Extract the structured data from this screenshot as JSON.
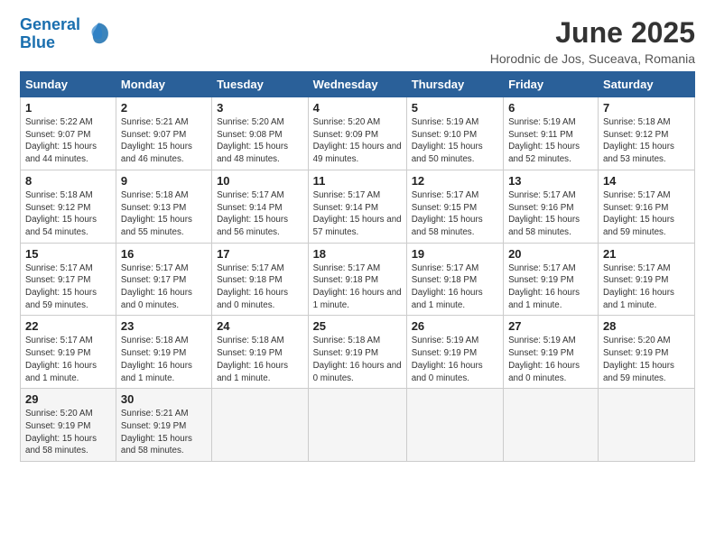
{
  "logo": {
    "line1": "General",
    "line2": "Blue"
  },
  "title": "June 2025",
  "subtitle": "Horodnic de Jos, Suceava, Romania",
  "weekdays": [
    "Sunday",
    "Monday",
    "Tuesday",
    "Wednesday",
    "Thursday",
    "Friday",
    "Saturday"
  ],
  "weeks": [
    [
      {
        "day": "1",
        "sunrise": "Sunrise: 5:22 AM",
        "sunset": "Sunset: 9:07 PM",
        "daylight": "Daylight: 15 hours and 44 minutes."
      },
      {
        "day": "2",
        "sunrise": "Sunrise: 5:21 AM",
        "sunset": "Sunset: 9:07 PM",
        "daylight": "Daylight: 15 hours and 46 minutes."
      },
      {
        "day": "3",
        "sunrise": "Sunrise: 5:20 AM",
        "sunset": "Sunset: 9:08 PM",
        "daylight": "Daylight: 15 hours and 48 minutes."
      },
      {
        "day": "4",
        "sunrise": "Sunrise: 5:20 AM",
        "sunset": "Sunset: 9:09 PM",
        "daylight": "Daylight: 15 hours and 49 minutes."
      },
      {
        "day": "5",
        "sunrise": "Sunrise: 5:19 AM",
        "sunset": "Sunset: 9:10 PM",
        "daylight": "Daylight: 15 hours and 50 minutes."
      },
      {
        "day": "6",
        "sunrise": "Sunrise: 5:19 AM",
        "sunset": "Sunset: 9:11 PM",
        "daylight": "Daylight: 15 hours and 52 minutes."
      },
      {
        "day": "7",
        "sunrise": "Sunrise: 5:18 AM",
        "sunset": "Sunset: 9:12 PM",
        "daylight": "Daylight: 15 hours and 53 minutes."
      }
    ],
    [
      {
        "day": "8",
        "sunrise": "Sunrise: 5:18 AM",
        "sunset": "Sunset: 9:12 PM",
        "daylight": "Daylight: 15 hours and 54 minutes."
      },
      {
        "day": "9",
        "sunrise": "Sunrise: 5:18 AM",
        "sunset": "Sunset: 9:13 PM",
        "daylight": "Daylight: 15 hours and 55 minutes."
      },
      {
        "day": "10",
        "sunrise": "Sunrise: 5:17 AM",
        "sunset": "Sunset: 9:14 PM",
        "daylight": "Daylight: 15 hours and 56 minutes."
      },
      {
        "day": "11",
        "sunrise": "Sunrise: 5:17 AM",
        "sunset": "Sunset: 9:14 PM",
        "daylight": "Daylight: 15 hours and 57 minutes."
      },
      {
        "day": "12",
        "sunrise": "Sunrise: 5:17 AM",
        "sunset": "Sunset: 9:15 PM",
        "daylight": "Daylight: 15 hours and 58 minutes."
      },
      {
        "day": "13",
        "sunrise": "Sunrise: 5:17 AM",
        "sunset": "Sunset: 9:16 PM",
        "daylight": "Daylight: 15 hours and 58 minutes."
      },
      {
        "day": "14",
        "sunrise": "Sunrise: 5:17 AM",
        "sunset": "Sunset: 9:16 PM",
        "daylight": "Daylight: 15 hours and 59 minutes."
      }
    ],
    [
      {
        "day": "15",
        "sunrise": "Sunrise: 5:17 AM",
        "sunset": "Sunset: 9:17 PM",
        "daylight": "Daylight: 15 hours and 59 minutes."
      },
      {
        "day": "16",
        "sunrise": "Sunrise: 5:17 AM",
        "sunset": "Sunset: 9:17 PM",
        "daylight": "Daylight: 16 hours and 0 minutes."
      },
      {
        "day": "17",
        "sunrise": "Sunrise: 5:17 AM",
        "sunset": "Sunset: 9:18 PM",
        "daylight": "Daylight: 16 hours and 0 minutes."
      },
      {
        "day": "18",
        "sunrise": "Sunrise: 5:17 AM",
        "sunset": "Sunset: 9:18 PM",
        "daylight": "Daylight: 16 hours and 1 minute."
      },
      {
        "day": "19",
        "sunrise": "Sunrise: 5:17 AM",
        "sunset": "Sunset: 9:18 PM",
        "daylight": "Daylight: 16 hours and 1 minute."
      },
      {
        "day": "20",
        "sunrise": "Sunrise: 5:17 AM",
        "sunset": "Sunset: 9:19 PM",
        "daylight": "Daylight: 16 hours and 1 minute."
      },
      {
        "day": "21",
        "sunrise": "Sunrise: 5:17 AM",
        "sunset": "Sunset: 9:19 PM",
        "daylight": "Daylight: 16 hours and 1 minute."
      }
    ],
    [
      {
        "day": "22",
        "sunrise": "Sunrise: 5:17 AM",
        "sunset": "Sunset: 9:19 PM",
        "daylight": "Daylight: 16 hours and 1 minute."
      },
      {
        "day": "23",
        "sunrise": "Sunrise: 5:18 AM",
        "sunset": "Sunset: 9:19 PM",
        "daylight": "Daylight: 16 hours and 1 minute."
      },
      {
        "day": "24",
        "sunrise": "Sunrise: 5:18 AM",
        "sunset": "Sunset: 9:19 PM",
        "daylight": "Daylight: 16 hours and 1 minute."
      },
      {
        "day": "25",
        "sunrise": "Sunrise: 5:18 AM",
        "sunset": "Sunset: 9:19 PM",
        "daylight": "Daylight: 16 hours and 0 minutes."
      },
      {
        "day": "26",
        "sunrise": "Sunrise: 5:19 AM",
        "sunset": "Sunset: 9:19 PM",
        "daylight": "Daylight: 16 hours and 0 minutes."
      },
      {
        "day": "27",
        "sunrise": "Sunrise: 5:19 AM",
        "sunset": "Sunset: 9:19 PM",
        "daylight": "Daylight: 16 hours and 0 minutes."
      },
      {
        "day": "28",
        "sunrise": "Sunrise: 5:20 AM",
        "sunset": "Sunset: 9:19 PM",
        "daylight": "Daylight: 15 hours and 59 minutes."
      }
    ],
    [
      {
        "day": "29",
        "sunrise": "Sunrise: 5:20 AM",
        "sunset": "Sunset: 9:19 PM",
        "daylight": "Daylight: 15 hours and 58 minutes."
      },
      {
        "day": "30",
        "sunrise": "Sunrise: 5:21 AM",
        "sunset": "Sunset: 9:19 PM",
        "daylight": "Daylight: 15 hours and 58 minutes."
      },
      null,
      null,
      null,
      null,
      null
    ]
  ]
}
